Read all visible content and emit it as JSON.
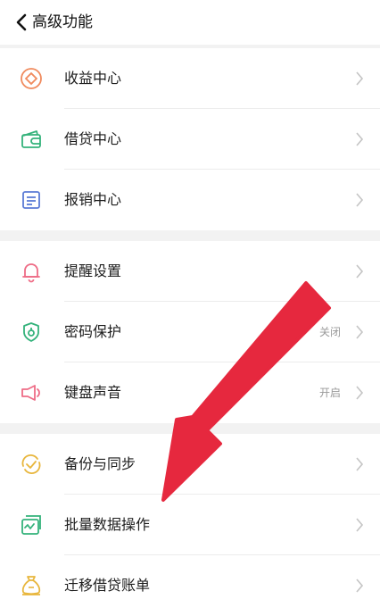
{
  "header": {
    "title": "高级功能"
  },
  "colors": {
    "orange": "#f08a5d",
    "green": "#34b27b",
    "blue": "#5b7bd5",
    "pink": "#ee6c86",
    "yellow": "#e8b63d",
    "red_arrow": "#e6283e"
  },
  "groups": [
    {
      "items": [
        {
          "label": "收益中心",
          "icon": "income-icon"
        },
        {
          "label": "借贷中心",
          "icon": "wallet-icon"
        },
        {
          "label": "报销中心",
          "icon": "receipt-icon"
        }
      ]
    },
    {
      "items": [
        {
          "label": "提醒设置",
          "icon": "bell-icon"
        },
        {
          "label": "密码保护",
          "icon": "lock-shield-icon",
          "value": "关闭"
        },
        {
          "label": "键盘声音",
          "icon": "speaker-icon",
          "value": "开启"
        }
      ]
    },
    {
      "items": [
        {
          "label": "备份与同步",
          "icon": "sync-icon"
        },
        {
          "label": "批量数据操作",
          "icon": "batch-data-icon"
        },
        {
          "label": "迁移借贷账单",
          "icon": "money-bag-icon"
        }
      ]
    }
  ]
}
